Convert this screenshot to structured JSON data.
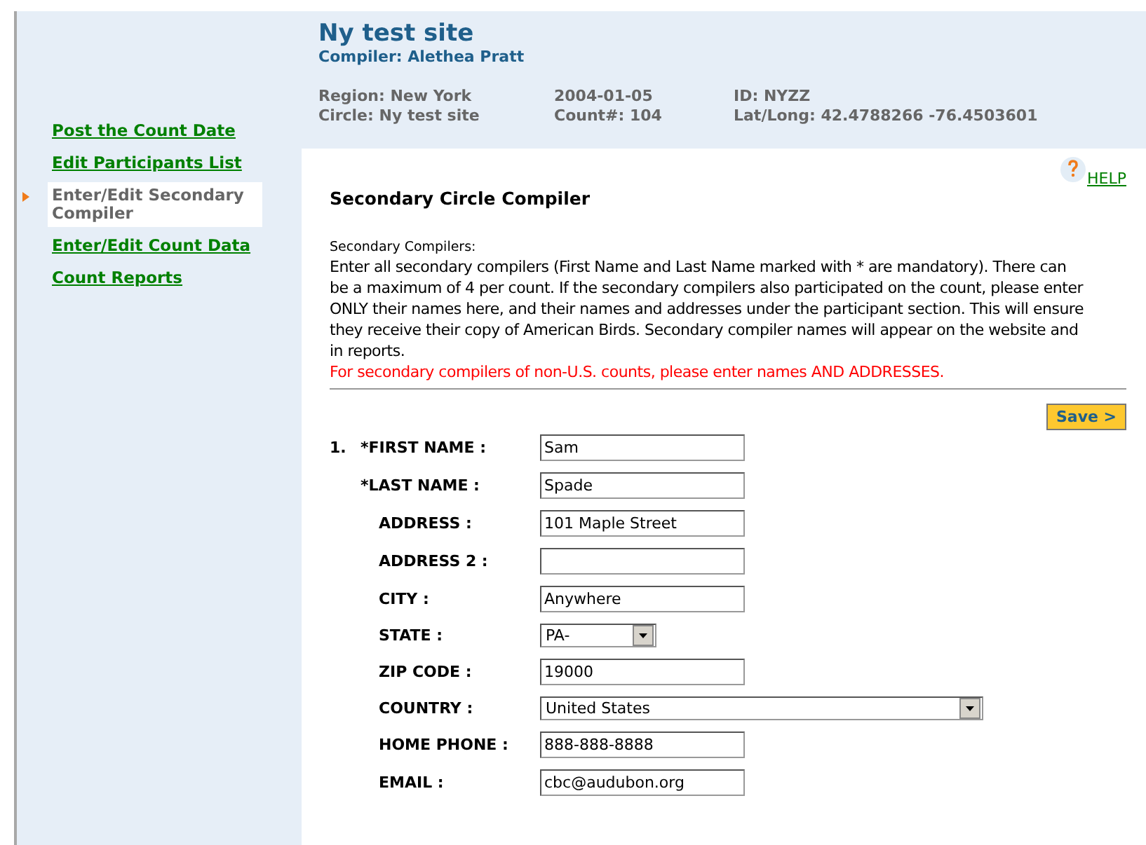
{
  "site": {
    "title": "Ny test site",
    "compiler": "Compiler: Alethea Pratt"
  },
  "meta": [
    [
      "Region: New York",
      "Circle: Ny test site"
    ],
    [
      "2004-01-05",
      "Count#: 104"
    ],
    [
      "ID: NYZZ",
      "Lat/Long: 42.4788266 -76.4503601"
    ]
  ],
  "sidebar": {
    "items": [
      {
        "label": "Post the Count Date",
        "selected": false
      },
      {
        "label": "Edit Participants List",
        "selected": false
      },
      {
        "label": "Enter/Edit Secondary Compiler",
        "selected": true
      },
      {
        "label": "Enter/Edit Count Data",
        "selected": false
      },
      {
        "label": "Count Reports",
        "selected": false
      }
    ]
  },
  "help": "HELP",
  "heading": "Secondary Circle Compiler",
  "intro_label": "Secondary Compilers:",
  "intro": "Enter all secondary compilers (First Name and Last Name marked with * are mandatory). There can be a maximum of 4 per count. If the secondary compilers also participated on the count, please enter ONLY their names here, and their names and addresses under the participant section. This will ensure they receive their copy of American Birds. Secondary compiler names will appear on the website and in reports.",
  "warning": "For secondary compilers of non-U.S. counts, please enter names AND ADDRESSES.",
  "save_button": "Save >",
  "entry_number": "1.",
  "fields": [
    {
      "label": "*FIRST NAME :",
      "kind": "text",
      "required": true,
      "value": "Sam"
    },
    {
      "label": "*LAST NAME :",
      "kind": "text",
      "required": true,
      "value": "Spade"
    },
    {
      "label": "ADDRESS :",
      "kind": "text",
      "required": false,
      "value": "101 Maple Street"
    },
    {
      "label": "ADDRESS 2 :",
      "kind": "text",
      "required": false
    },
    {
      "label": "CITY :",
      "kind": "text",
      "required": false,
      "value": "Anywhere"
    },
    {
      "label": "STATE :",
      "kind": "select",
      "required": false,
      "value": "PA-"
    },
    {
      "label": "ZIP CODE :",
      "kind": "text",
      "required": false,
      "value": "19000"
    },
    {
      "label": "COUNTRY :",
      "kind": "wideselect",
      "required": false,
      "value": "United States"
    },
    {
      "label": "HOME PHONE :",
      "kind": "text",
      "required": false,
      "value": "888-888-8888"
    },
    {
      "label": "EMAIL :",
      "kind": "text",
      "required": false,
      "value": "cbc@audubon.org"
    }
  ]
}
